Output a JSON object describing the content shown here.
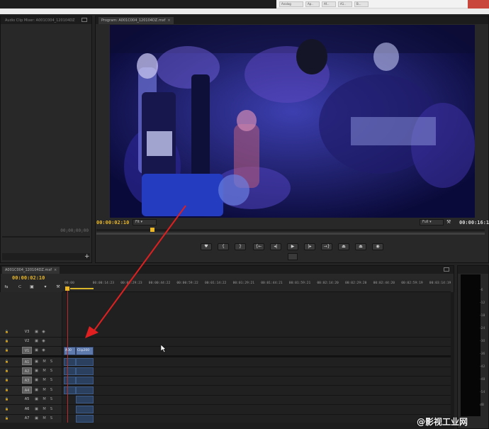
{
  "os": {
    "buttons": [
      "Analog",
      "Ap..",
      "Af...",
      "A1..",
      "B..."
    ]
  },
  "audio_mixer": {
    "tab": "Audio Clip Mixer: A001C004_120104DZ",
    "timecode": "00;00;00;00"
  },
  "program_monitor": {
    "tab": "Program: A001C004_120104DZ.mxf",
    "timecode_left": "00:00:02:10",
    "fit": "Fit",
    "quality": "Full",
    "timecode_right": "00:00:16:12",
    "buttons": [
      {
        "name": "add-marker-button",
        "glyph": "♥"
      },
      {
        "name": "mark-in-button",
        "glyph": "{"
      },
      {
        "name": "mark-out-button",
        "glyph": "}"
      },
      {
        "name": "go-to-in-button",
        "glyph": "{←"
      },
      {
        "name": "step-back-button",
        "glyph": "◂|"
      },
      {
        "name": "play-button",
        "glyph": "▶"
      },
      {
        "name": "step-forward-button",
        "glyph": "|▸"
      },
      {
        "name": "go-to-out-button",
        "glyph": "→}"
      },
      {
        "name": "lift-button",
        "glyph": "⏏"
      },
      {
        "name": "extract-button",
        "glyph": "⏏"
      },
      {
        "name": "export-frame-button",
        "glyph": "◉"
      }
    ]
  },
  "timeline": {
    "tab": "A001C004_120104DZ.mxf",
    "timecode": "00:00:02:10",
    "ruler": [
      "00:00",
      "00:00:14:23",
      "00:00:29:23",
      "00:00:44:22",
      "00:00:59:22",
      "00:01:14:22",
      "00:01:29:21",
      "00:01:44:21",
      "00:01:59:21",
      "00:02:14:20",
      "00:02:29:20",
      "00:02:44:20",
      "00:02:59:19",
      "00:03:14:19"
    ],
    "video_tracks": [
      {
        "label": "V3",
        "targeted": false
      },
      {
        "label": "V2",
        "targeted": false
      },
      {
        "label": "V1",
        "targeted": true
      }
    ],
    "audio_tracks": [
      {
        "label": "A1",
        "targeted": true
      },
      {
        "label": "A2",
        "targeted": true
      },
      {
        "label": "A3",
        "targeted": true
      },
      {
        "label": "A4",
        "targeted": true
      },
      {
        "label": "A5",
        "targeted": false
      },
      {
        "label": "A6",
        "targeted": false
      },
      {
        "label": "A7",
        "targeted": false
      }
    ],
    "clip_labels": [
      "A00",
      "Clip200"
    ],
    "mute_label": "M",
    "solo_label": "S"
  },
  "meter": {
    "scale": [
      "-6",
      "-12",
      "-18",
      "-24",
      "-30",
      "-36",
      "-42",
      "-48",
      "-54",
      "dB"
    ]
  },
  "watermark": "@影视工业网",
  "colors": {
    "timecode": "#e8b628",
    "playhead": "#b32d2d",
    "clip": "#5e79ab",
    "annotation_arrow": "#e02020"
  }
}
